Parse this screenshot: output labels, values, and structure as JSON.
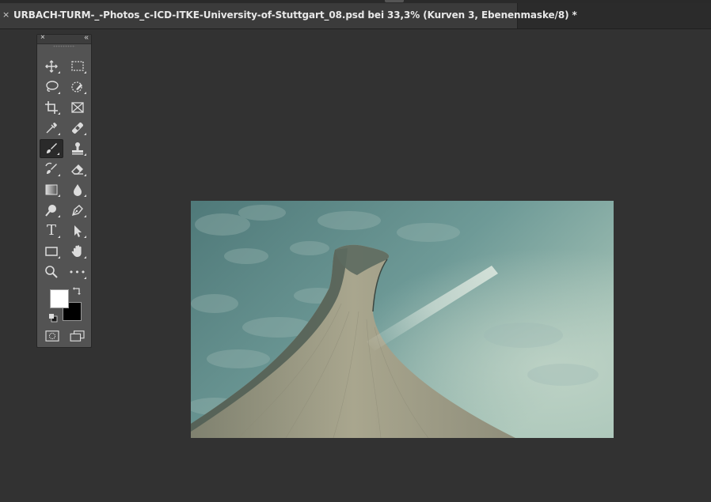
{
  "document_tab": {
    "close_glyph": "×",
    "title": "URBACH-TURM-_-Photos_c-ICD-ITKE-University-of-Stuttgart_08.psd bei 33,3% (Kurven 3, Ebenenmaske/8) *"
  },
  "toolbar": {
    "close_glyph": "×",
    "collapse_glyph": "‹‹",
    "tools": [
      {
        "name": "move-tool",
        "icon": "move-icon"
      },
      {
        "name": "rectangular-marquee-tool",
        "icon": "marquee-icon"
      },
      {
        "name": "lasso-tool",
        "icon": "lasso-icon"
      },
      {
        "name": "quick-selection-tool",
        "icon": "quick-selection-icon"
      },
      {
        "name": "crop-tool",
        "icon": "crop-icon"
      },
      {
        "name": "frame-tool",
        "icon": "frame-icon"
      },
      {
        "name": "eyedropper-tool",
        "icon": "eyedropper-icon"
      },
      {
        "name": "healing-brush-tool",
        "icon": "bandage-icon"
      },
      {
        "name": "brush-tool",
        "icon": "brush-icon",
        "active": true
      },
      {
        "name": "clone-stamp-tool",
        "icon": "stamp-icon"
      },
      {
        "name": "history-brush-tool",
        "icon": "history-brush-icon"
      },
      {
        "name": "eraser-tool",
        "icon": "eraser-icon"
      },
      {
        "name": "gradient-tool",
        "icon": "gradient-icon"
      },
      {
        "name": "blur-tool",
        "icon": "drop-icon"
      },
      {
        "name": "dodge-tool",
        "icon": "dodge-icon"
      },
      {
        "name": "pen-tool",
        "icon": "pen-icon"
      },
      {
        "name": "type-tool",
        "icon": "type-icon",
        "glyph": "T"
      },
      {
        "name": "path-selection-tool",
        "icon": "arrow-icon"
      },
      {
        "name": "rectangle-tool",
        "icon": "rectangle-icon"
      },
      {
        "name": "hand-tool",
        "icon": "hand-icon"
      },
      {
        "name": "zoom-tool",
        "icon": "zoom-icon"
      },
      {
        "name": "more-tools",
        "icon": "ellipsis-icon",
        "glyph": "•••"
      }
    ],
    "foreground_color": "#ffffff",
    "background_color": "#000000"
  },
  "colors": {
    "workspace": "#323232",
    "panel": "#535353",
    "tab_active": "#3b3b3b",
    "icon": "#dcdcdc"
  }
}
